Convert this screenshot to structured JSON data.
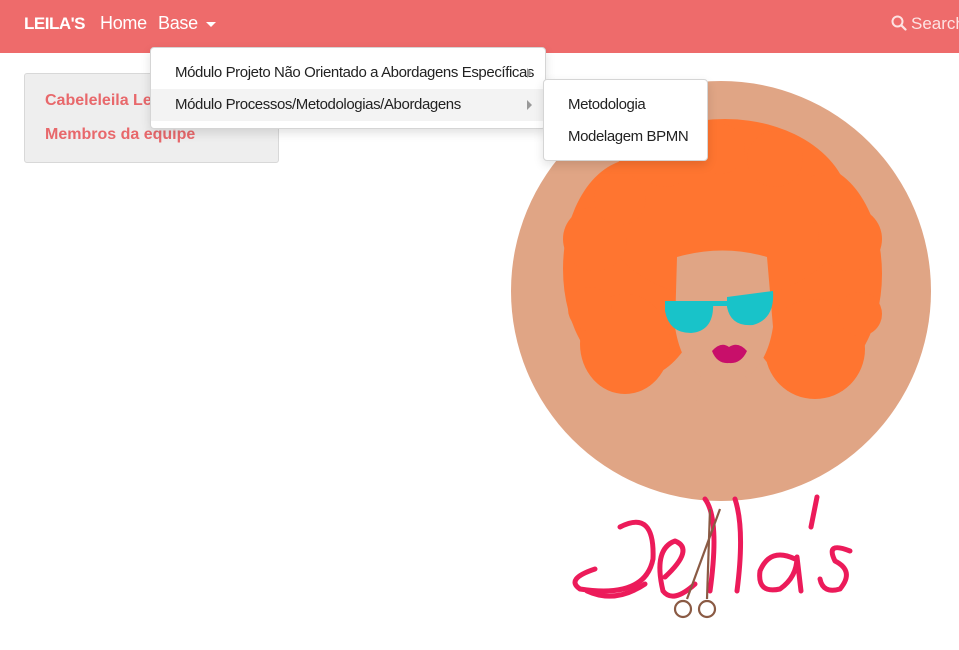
{
  "navbar": {
    "brand": "LEILA'S",
    "home_label": "Home",
    "base_label": "Base",
    "search_label": "Search",
    "color": "#ee6b6b"
  },
  "sidebar": {
    "items": [
      {
        "label": "Cabeleleila Leila"
      },
      {
        "label": "Membros da equipe"
      }
    ]
  },
  "dropdown": {
    "items": [
      {
        "label": "Módulo Projeto Não Orientado a Abordagens Específicas"
      },
      {
        "label": "Módulo Processos/Metodologias/Abordagens"
      }
    ]
  },
  "submenu": {
    "items": [
      {
        "label": "Metodologia"
      },
      {
        "label": "Modelagem BPMN"
      }
    ]
  },
  "logo": {
    "text": "Leila's",
    "colors": {
      "circle": "#e0a585",
      "hair": "#ff7530",
      "glasses": "#18c3c9",
      "lips": "#c80f6a",
      "script": "#ec1b5a"
    }
  }
}
